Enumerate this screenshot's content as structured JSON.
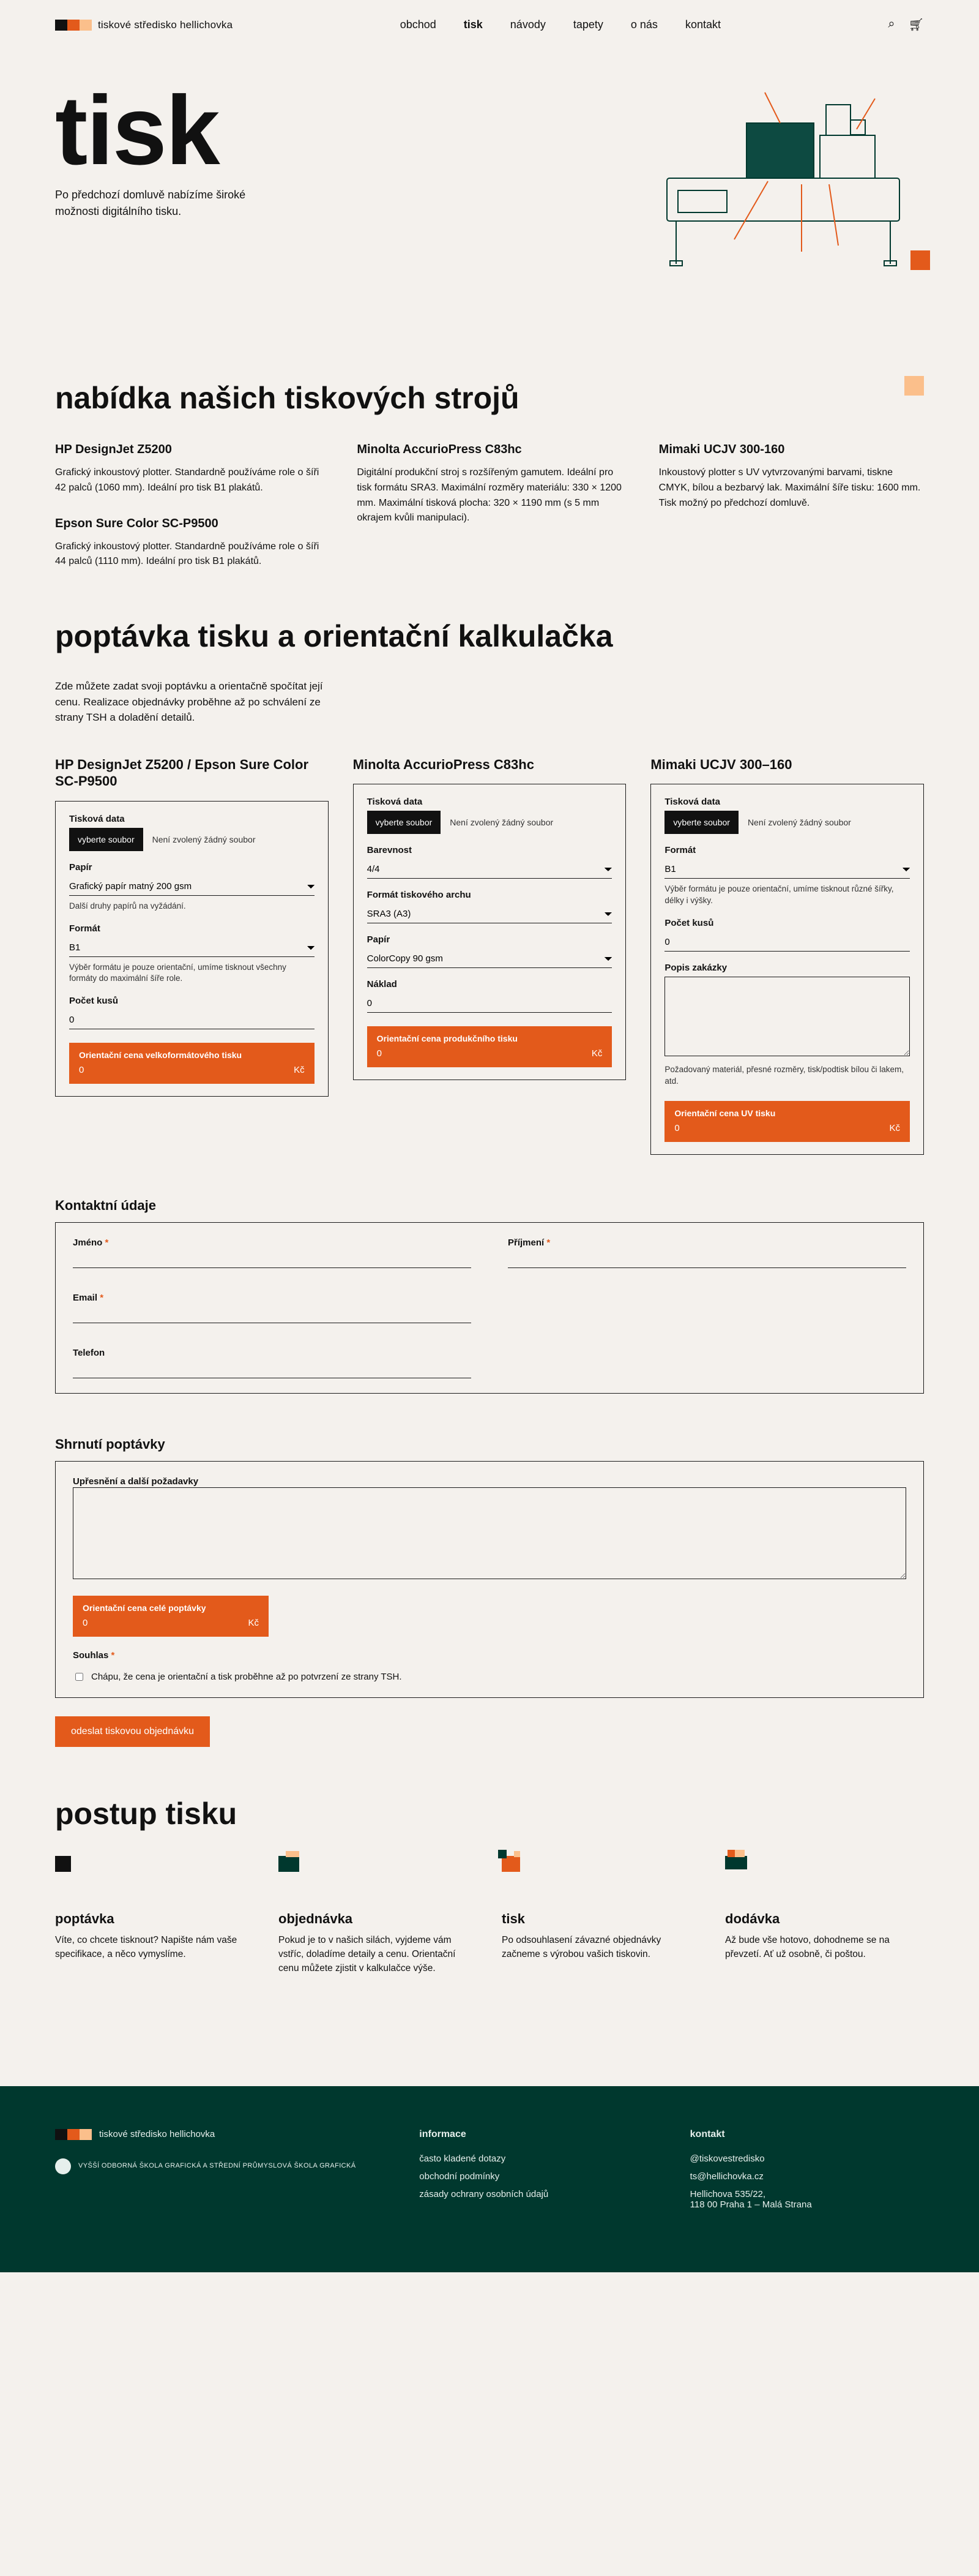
{
  "nav": {
    "items": [
      "obchod",
      "tisk",
      "návody",
      "tapety",
      "o nás",
      "kontakt"
    ],
    "activeIndex": 1
  },
  "brand": "tiskové středisko hellichovka",
  "hero": {
    "title": "tisk",
    "desc": "Po předchozí domluvě nabízíme široké možnosti digitálního tisku."
  },
  "machinesHeading": "nabídka našich tiskových strojů",
  "machines": {
    "col1": [
      {
        "name": "HP DesignJet Z5200",
        "desc": "Grafický inkoustový plotter. Standardně používáme role o šíři 42 palců (1060 mm). Ideální pro tisk B1 plakátů."
      },
      {
        "name": "Epson Sure Color SC-P9500",
        "desc": "Grafický inkoustový plotter. Standardně používáme role o šíři 44 palců (1110 mm). Ideální pro tisk B1 plakátů."
      }
    ],
    "col2": {
      "name": "Minolta AccurioPress C83hc",
      "desc": "Digitální produkční stroj s rozšířeným gamutem. Ideální pro tisk formátu SRA3. Maximální rozměry materiálu: 330 × 1200 mm. Maximální tisková plocha: 320 × 1190 mm (s 5 mm okrajem kvůli manipulaci)."
    },
    "col3": {
      "name": "Mimaki UCJV 300-160",
      "desc": "Inkoustový plotter s UV vytvrzovanými barvami, tiskne CMYK, bílou a bezbarvý lak. Maximální šíře tisku: 1600 mm. Tisk možný po předchozí domluvě."
    }
  },
  "calcHeading": "poptávka tisku a orientační kalkulačka",
  "calcIntro": "Zde můžete zadat svoji poptávku a orientačně spočítat její cenu. Realizace objednávky proběhne až po schválení ze strany TSH a doladění detailů.",
  "labels": {
    "printData": "Tisková data",
    "chooseFile": "vyberte soubor",
    "noFile": "Není zvolený žádný soubor",
    "paper": "Papír",
    "paperHint": "Další druhy papírů na vyžádání.",
    "format": "Formát",
    "formatHint": "Výběr formátu je pouze orientační, umíme tisknout všechny formáty do maximální šíře role.",
    "format3Hint": "Výběr formátu je pouze orientační, umíme tisknout různé šířky, délky i výšky.",
    "qty": "Počet kusů",
    "colorness": "Barevnost",
    "sheetFormat": "Formát tiskového archu",
    "imposition": "Náklad",
    "orderDesc": "Popis zakázky",
    "orderDescHint": "Požadovaný materiál, přesné rozměry, tisk/podtisk bílou či lakem, atd."
  },
  "cols": {
    "c1": {
      "title": "HP DesignJet Z5200 / Epson Sure Color SC-P9500",
      "paper": "Grafický papír matný 200 gsm",
      "format": "B1",
      "qty": "0",
      "price": {
        "label": "Orientační cena velkoformátového tisku",
        "value": "0",
        "currency": "Kč"
      }
    },
    "c2": {
      "title": "Minolta AccurioPress C83hc",
      "color": "4/4",
      "sheet": "SRA3 (A3)",
      "paper": "ColorCopy 90 gsm",
      "imposition": "0",
      "price": {
        "label": "Orientační cena produkčního tisku",
        "value": "0",
        "currency": "Kč"
      }
    },
    "c3": {
      "title": "Mimaki UCJV 300–160",
      "format": "B1",
      "qty": "0",
      "price": {
        "label": "Orientační cena UV tisku",
        "value": "0",
        "currency": "Kč"
      }
    }
  },
  "contact": {
    "heading": "Kontaktní údaje",
    "fields": {
      "firstname": "Jméno",
      "lastname": "Příjmení",
      "email": "Email",
      "phone": "Telefon"
    }
  },
  "summary": {
    "heading": "Shrnutí poptávky",
    "notesLabel": "Upřesnění a další požadavky",
    "totalLabel": "Orientační cena celé poptávky",
    "totalValue": "0",
    "currency": "Kč",
    "consentLabel": "Souhlas",
    "consentText": "Chápu, že cena je orientační a tisk proběhne až po potvrzení ze strany TSH."
  },
  "submit": "odeslat tiskovou objednávku",
  "processHeading": "postup tisku",
  "process": [
    {
      "title": "poptávka",
      "desc": "Víte, co chcete tisknout? Napište nám vaše specifikace, a něco vymyslíme."
    },
    {
      "title": "objednávka",
      "desc": "Pokud je to v našich silách, vyjdeme vám vstříc, doladíme detaily a cenu. Orientační cenu můžete zjistit v kalkulačce výše."
    },
    {
      "title": "tisk",
      "desc": "Po odsouhlasení závazné objednávky začneme s výrobou vašich tiskovin."
    },
    {
      "title": "dodávka",
      "desc": "Až bude vše hotovo, dohodneme se na převzetí. Ať už osobně, či poštou."
    }
  ],
  "footer": {
    "brand": "tiskové středisko hellichovka",
    "school": "VYŠŠÍ ODBORNÁ ŠKOLA GRAFICKÁ A STŘEDNÍ PRŮMYSLOVÁ ŠKOLA GRAFICKÁ",
    "info": {
      "heading": "informace",
      "links": [
        "často kladené dotazy",
        "obchodní podmínky",
        "zásady ochrany osobních údajů"
      ]
    },
    "contact": {
      "heading": "kontakt",
      "items": [
        "@tiskovestredisko",
        "ts@hellichovka.cz",
        "Hellichova 535/22,\n118 00 Praha 1 – Malá Strana"
      ]
    }
  }
}
